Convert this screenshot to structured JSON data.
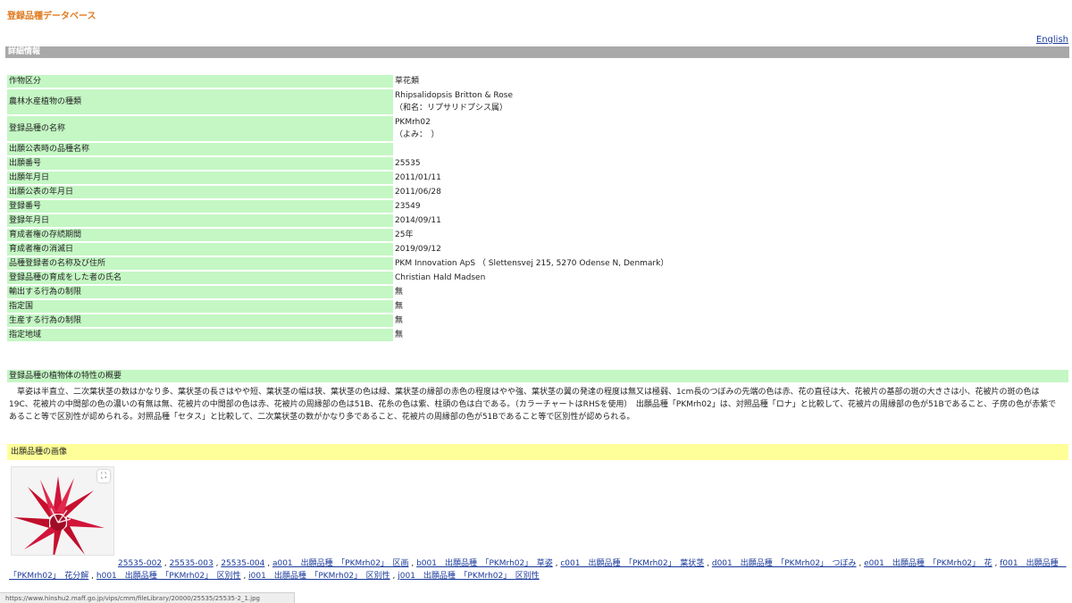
{
  "site_title": "登録品種データベース",
  "english_link": "English",
  "section_title": "詳細情報",
  "details": [
    {
      "key": "作物区分",
      "value": "草花類"
    },
    {
      "key": "農林水産植物の種類",
      "value": "Rhipsalidopsis Britton & Rose",
      "value2": "（和名：リプサリドプシス属）"
    },
    {
      "key": "登録品種の名称",
      "value": "PKMrh02",
      "value2": "（よみ：　）"
    },
    {
      "key": "出願公表時の品種名称",
      "value": ""
    },
    {
      "key": "出願番号",
      "value": "25535"
    },
    {
      "key": "出願年月日",
      "value": "2011/01/11"
    },
    {
      "key": "出願公表の年月日",
      "value": "2011/06/28"
    },
    {
      "key": "登録番号",
      "value": "23549"
    },
    {
      "key": "登録年月日",
      "value": "2014/09/11"
    },
    {
      "key": "育成者権の存続期間",
      "value": "25年"
    },
    {
      "key": "育成者権の消滅日",
      "value": "2019/09/12"
    },
    {
      "key": "品種登録者の名称及び住所",
      "value": "PKM Innovation ApS （ Slettensvej 215, 5270 Odense N, Denmark）"
    },
    {
      "key": "登録品種の育成をした者の氏名",
      "value": "Christian Hald Madsen"
    },
    {
      "key": "輸出する行為の制限",
      "value": "無"
    },
    {
      "key": "指定国",
      "value": "無"
    },
    {
      "key": "生産する行為の制限",
      "value": "無"
    },
    {
      "key": "指定地域",
      "value": "無"
    }
  ],
  "summary": {
    "header": "登録品種の植物体の特性の概要",
    "text": "草姿は半直立、二次葉状茎の数はかなり多、葉状茎の長さはやや短、葉状茎の幅は狭、葉状茎の色は緑、葉状茎の縁部の赤色の程度はやや強、葉状茎の翼の発達の程度は無又は極弱、1cm長のつぼみの先端の色は赤、花の直径は大、花被片の基部の斑の大きさは小、花被片の斑の色は19C、花被片の中間部の色の濃いの有無は無、花被片の中間部の色は赤、花被片の周縁部の色は51B、花糸の色は紫、柱頭の色は白である。（カラーチャートはRHSを使用）　出願品種「PKMrh02」は、対照品種「ロナ」と比較して、花被片の周縁部の色が51Bであること、子房の色が赤紫であること等で区別性が認められる。対照品種「セタス」と比較して、二次葉状茎の数がかなり多であること、花被片の周縁部の色が51Bであること等で区別性が認められる。"
  },
  "image_section": {
    "header": "出願品種の画像",
    "zoom_icon": "expand-icon",
    "links": [
      "25535-002",
      "25535-003",
      "25535-004",
      "a001　出願品種　「PKMrh02」　区画",
      "b001　出願品種　「PKMrh02」　草姿",
      "c001　出願品種　「PKMrh02」　葉状茎",
      "d001　出願品種　「PKMrh02」　つぼみ",
      "e001　出願品種　「PKMrh02」　花",
      "f001　出願品種　「PKMrh02」　花分解",
      "h001　出願品種　「PKMrh02」　区別性",
      "i001　出願品種　「PKMrh02」　区別性",
      "j001　出願品種　「PKMrh02」　区別性"
    ]
  },
  "status_bar": "https://www.hinshu2.maff.go.jp/vips/cmm/fileLibrary/20000/25535/25535-2_1.jpg",
  "colors": {
    "title_orange": "#e07a1f",
    "key_green": "#c4f7c4",
    "section_gray": "#a9a9a9",
    "image_header_yellow": "#ffff99",
    "link_blue": "#1a3a9a"
  }
}
